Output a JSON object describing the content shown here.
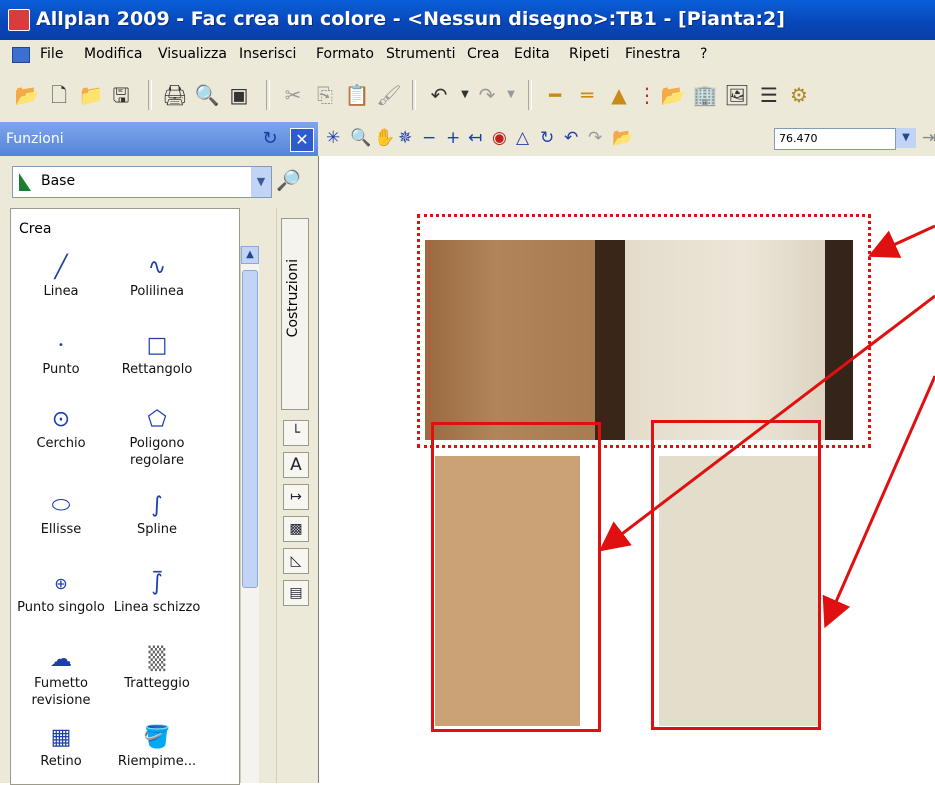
{
  "window": {
    "title": "Allplan 2009 - Fac crea un colore - <Nessun disegno>:TB1 - [Pianta:2]"
  },
  "menu": [
    "File",
    "Modifica",
    "Visualizza",
    "Inserisci",
    "Formato",
    "Strumenti",
    "Crea",
    "Edita",
    "Ripeti",
    "Finestra",
    "?"
  ],
  "functions_panel": {
    "title": "Funzioni",
    "module": "Base",
    "category": "Crea",
    "vertical_tab": "Costruzioni",
    "items": [
      {
        "label": "Linea",
        "icon": "line-icon"
      },
      {
        "label": "Polilinea",
        "icon": "polyline-icon"
      },
      {
        "label": "Punto",
        "icon": "point-icon"
      },
      {
        "label": "Rettangolo",
        "icon": "rectangle-icon"
      },
      {
        "label": "Cerchio",
        "icon": "circle-icon"
      },
      {
        "label": "Poligono regolare",
        "icon": "polygon-icon"
      },
      {
        "label": "Ellisse",
        "icon": "ellipse-icon"
      },
      {
        "label": "Spline",
        "icon": "spline-icon"
      },
      {
        "label": "Punto singolo",
        "icon": "single-point-icon"
      },
      {
        "label": "Linea schizzo",
        "icon": "sketch-line-icon"
      },
      {
        "label": "Fumetto revisione",
        "icon": "revision-cloud-icon"
      },
      {
        "label": "Tratteggio",
        "icon": "hatch-icon"
      },
      {
        "label": "Retino",
        "icon": "pattern-icon"
      },
      {
        "label": "Riempime...",
        "icon": "fill-icon"
      }
    ]
  },
  "view_toolbar": {
    "zoom_value": "76.470"
  },
  "colors": {
    "title_bar": "#0746b8",
    "annotation_red": "#e01010",
    "swatch_brown": "#cba176",
    "swatch_beige": "#e3ddcb"
  }
}
